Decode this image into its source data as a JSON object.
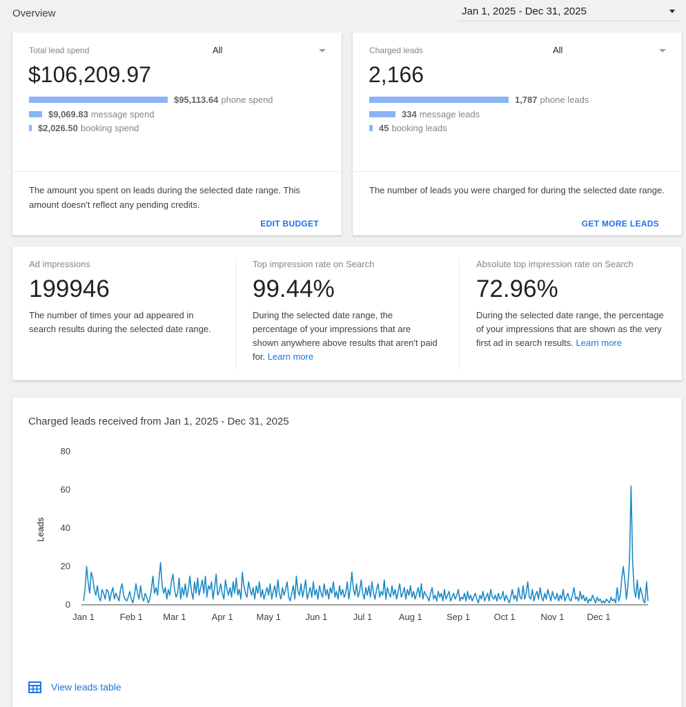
{
  "header": {
    "title": "Overview",
    "date_range": "Jan 1, 2025 - Dec 31, 2025"
  },
  "spend_card": {
    "label": "Total lead spend",
    "filter": "All",
    "value": "$106,209.97",
    "rows": [
      {
        "value": "$95,113.64",
        "label": "phone spend",
        "share": 0.8955
      },
      {
        "value": "$9,069.83",
        "label": "message spend",
        "share": 0.0854
      },
      {
        "value": "$2,026.50",
        "label": "booking spend",
        "share": 0.0191
      }
    ],
    "description": "The amount you spent on leads during the selected date range. This amount doesn't reflect any pending credits.",
    "action": "EDIT BUDGET"
  },
  "leads_card": {
    "label": "Charged leads",
    "filter": "All",
    "value": "2,166",
    "rows": [
      {
        "value": "1,787",
        "label": "phone leads",
        "share": 0.825
      },
      {
        "value": "334",
        "label": "message leads",
        "share": 0.154
      },
      {
        "value": "45",
        "label": "booking leads",
        "share": 0.021
      }
    ],
    "description": "The number of leads you were charged for during the selected date range.",
    "action": "GET MORE LEADS"
  },
  "impressions_card": {
    "columns": [
      {
        "label": "Ad impressions",
        "value": "199946",
        "description": "The number of times your ad appeared in search results during the selected date range.",
        "link": ""
      },
      {
        "label": "Top impression rate on Search",
        "value": "99.44%",
        "description": "During the selected date range, the percentage of your impressions that are shown anywhere above results that aren't paid for.",
        "link": "Learn more"
      },
      {
        "label": "Absolute top impression rate on Search",
        "value": "72.96%",
        "description": "During the selected date range, the percentage of your impressions that are shown as the very first ad in search results.",
        "link": "Learn more"
      }
    ]
  },
  "chart_card": {
    "title": "Charged leads received from Jan 1, 2025 - Dec 31, 2025",
    "view_table": "View leads table",
    "icons": {
      "table": "table-icon"
    }
  },
  "colors": {
    "accent": "#1a73e8",
    "bar": "#8ab4f8",
    "line": "#1a8ac6"
  },
  "chart_data": {
    "type": "line",
    "title": "Charged leads received from Jan 1, 2025 - Dec 31, 2025",
    "xlabel": "",
    "ylabel": "Leads",
    "ylim": [
      0,
      80
    ],
    "yticks": [
      0,
      20,
      40,
      60,
      80
    ],
    "xticks": [
      "Jan 1",
      "Feb 1",
      "Mar 1",
      "Apr 1",
      "May 1",
      "Jun 1",
      "Jul 1",
      "Aug 1",
      "Sep 1",
      "Oct 1",
      "Nov 1",
      "Dec 1"
    ],
    "grid": false,
    "series": [
      {
        "name": "",
        "values": [
          2,
          8,
          20,
          12,
          6,
          17,
          14,
          8,
          5,
          10,
          4,
          2,
          8,
          6,
          3,
          8,
          7,
          2,
          6,
          9,
          3,
          6,
          4,
          2,
          8,
          11,
          5,
          3,
          2,
          4,
          7,
          3,
          1,
          5,
          11,
          6,
          3,
          10,
          4,
          2,
          6,
          4,
          1,
          3,
          8,
          15,
          6,
          9,
          5,
          14,
          22,
          10,
          6,
          9,
          3,
          8,
          5,
          12,
          16,
          8,
          4,
          6,
          14,
          3,
          9,
          5,
          11,
          4,
          8,
          15,
          7,
          3,
          12,
          6,
          14,
          5,
          9,
          13,
          6,
          15,
          4,
          10,
          8,
          12,
          3,
          9,
          16,
          5,
          7,
          11,
          6,
          3,
          13,
          8,
          5,
          9,
          4,
          12,
          6,
          14,
          5,
          8,
          3,
          17,
          10,
          6,
          4,
          12,
          8,
          5,
          9,
          3,
          10,
          6,
          12,
          4,
          8,
          3,
          6,
          9,
          5,
          11,
          3,
          7,
          10,
          4,
          13,
          6,
          3,
          9,
          5,
          8,
          12,
          4,
          2,
          6,
          10,
          3,
          15,
          7,
          5,
          11,
          4,
          8,
          13,
          3,
          6,
          9,
          4,
          12,
          5,
          8,
          3,
          10,
          6,
          4,
          11,
          5,
          8,
          3,
          9,
          6,
          12,
          4,
          7,
          3,
          10,
          5,
          8,
          4,
          6,
          12,
          3,
          9,
          17,
          8,
          5,
          11,
          4,
          7,
          13,
          6,
          3,
          9,
          5,
          10,
          4,
          12,
          6,
          3,
          8,
          11,
          4,
          7,
          5,
          13,
          3,
          9,
          6,
          4,
          10,
          5,
          8,
          3,
          7,
          11,
          4,
          6,
          9,
          3,
          8,
          5,
          10,
          4,
          7,
          3,
          6,
          9,
          4,
          11,
          3,
          7,
          5,
          4,
          2,
          6,
          9,
          3,
          5,
          2,
          7,
          4,
          6,
          2,
          8,
          3,
          5,
          7,
          2,
          4,
          6,
          3,
          5,
          8,
          2,
          4,
          3,
          6,
          2,
          7,
          3,
          5,
          2,
          4,
          6,
          3,
          1,
          5,
          3,
          7,
          2,
          4,
          6,
          2,
          8,
          4,
          3,
          5,
          2,
          6,
          3,
          4,
          7,
          2,
          5,
          3,
          1,
          4,
          8,
          3,
          5,
          2,
          9,
          4,
          3,
          10,
          3,
          6,
          12,
          4,
          3,
          8,
          2,
          5,
          7,
          3,
          9,
          4,
          2,
          6,
          3,
          8,
          5,
          2,
          7,
          4,
          3,
          6,
          2,
          5,
          3,
          8,
          2,
          4,
          6,
          3,
          2,
          5,
          9,
          3,
          4,
          2,
          7,
          3,
          5,
          2,
          4,
          1,
          3,
          2,
          5,
          3,
          1,
          4,
          2,
          3,
          1,
          2,
          1,
          3,
          2,
          1,
          4,
          2,
          3,
          1,
          9,
          2,
          5,
          14,
          20,
          12,
          3,
          10,
          24,
          62,
          22,
          8,
          4,
          13,
          3,
          9,
          6,
          2,
          1,
          12,
          2
        ]
      }
    ]
  }
}
